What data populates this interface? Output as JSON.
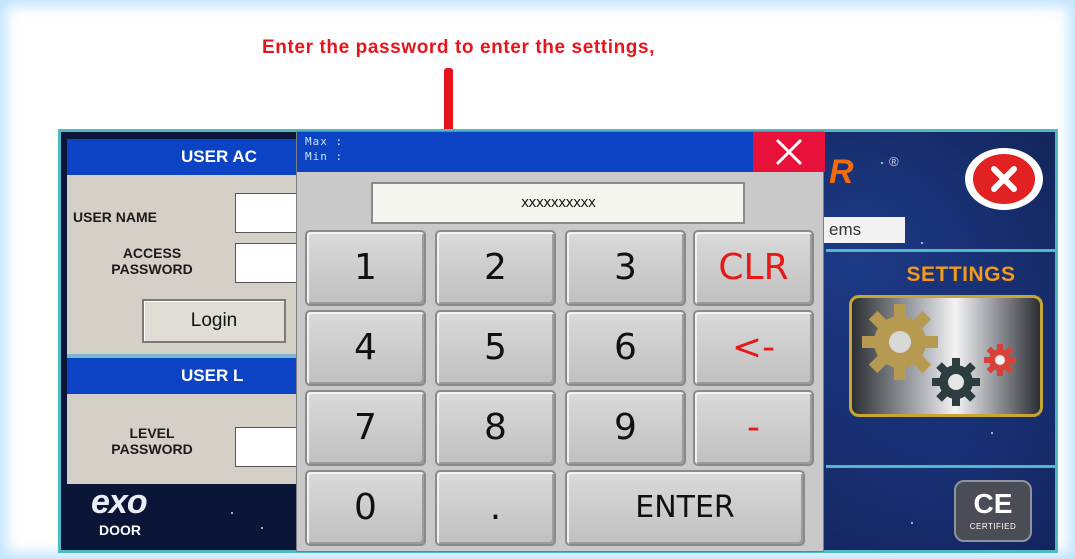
{
  "annotation": {
    "text": "Enter the password to enter the settings,"
  },
  "login_panel": {
    "access_header": "USER AC",
    "user_name_label": "USER NAME",
    "access_password_label_line1": "ACCESS",
    "access_password_label_line2": "PASSWORD",
    "login_button": "Login",
    "level_header": "USER L",
    "level_password_label_line1": "LEVEL",
    "level_password_label_line2": "PASSWORD"
  },
  "keypad": {
    "max_label": "Max :",
    "min_label": "Min :",
    "display_value": "xxxxxxxxxx",
    "keys": [
      "1",
      "2",
      "3",
      "CLR",
      "4",
      "5",
      "6",
      "<-",
      "7",
      "8",
      "9",
      "-",
      "0",
      ".",
      "ENTER"
    ]
  },
  "right_panel": {
    "brand_letter": "R",
    "registered_mark": "®",
    "items_tag": "ems",
    "settings_label": "SETTINGS",
    "ce_mark": "CE",
    "ce_certified": "CERTIFIED"
  },
  "footer_logo": {
    "brand": "exo",
    "sub": "DOOR"
  },
  "colors": {
    "annotation_red": "#e8141b",
    "title_blue": "#0c43c4",
    "close_red": "#e8113a",
    "settings_orange": "#f29a1c",
    "hmi_border_teal": "#4fb9c6"
  },
  "icons": [
    "close-x-icon",
    "close-circle-icon",
    "gears-icon",
    "ce-badge-icon"
  ]
}
